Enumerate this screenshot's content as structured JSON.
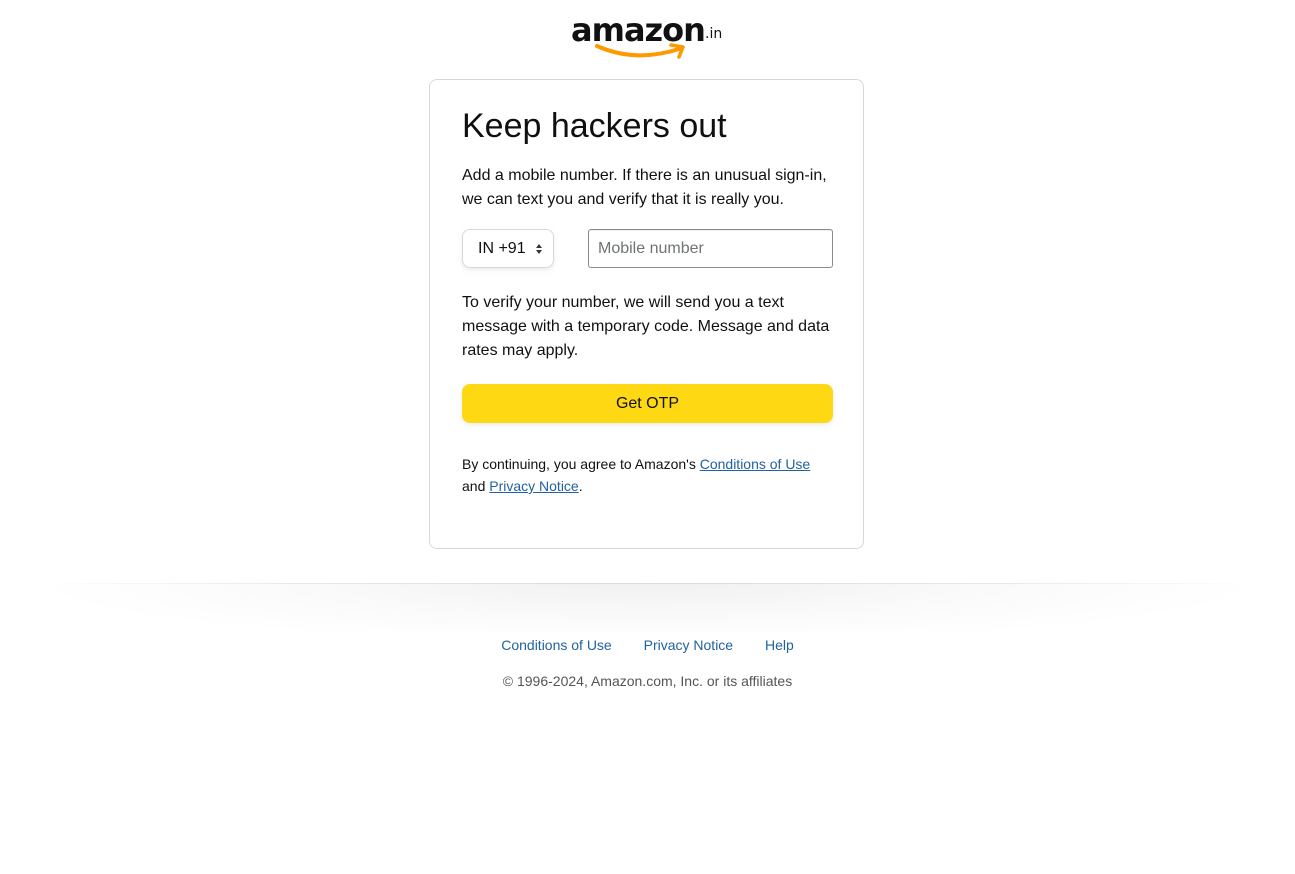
{
  "logo": {
    "word": "amazon",
    "suffix": ".in",
    "smile_color": "#ff9900"
  },
  "card": {
    "title": "Keep hackers out",
    "intro": "Add a mobile number. If there is an unusual sign-in, we can text you and verify that it is really you.",
    "country_code": "IN +91",
    "mobile_placeholder": "Mobile number",
    "mobile_value": "",
    "verify_note": "To verify your number, we will send you a text message with a temporary code. Message and data rates may apply.",
    "otp_button": "Get OTP",
    "legal_prefix": "By continuing, you agree to Amazon's ",
    "legal_conditions": "Conditions of Use",
    "legal_and": " and ",
    "legal_privacy": "Privacy Notice",
    "legal_suffix": "."
  },
  "footer": {
    "links": [
      "Conditions of Use",
      "Privacy Notice",
      "Help"
    ],
    "copyright": "© 1996-2024, Amazon.com, Inc. or its affiliates"
  },
  "colors": {
    "button_yellow": "#ffd814",
    "link_blue": "#2162a1",
    "text": "#0f1111",
    "border": "#d5d9d9"
  }
}
